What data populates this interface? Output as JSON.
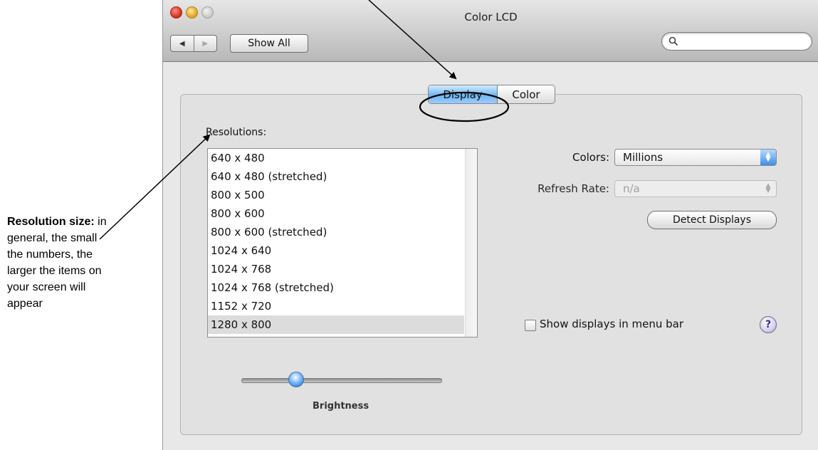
{
  "annotation": {
    "title_bold": "Resolution size:",
    "text": " in general, the small the numbers, the larger the items on your screen will appear"
  },
  "window": {
    "title": "Color LCD",
    "nav_back": "◀",
    "nav_forward": "▶",
    "show_all_label": "Show All",
    "search_value": ""
  },
  "tabs": [
    {
      "label": "Display",
      "selected": true
    },
    {
      "label": "Color",
      "selected": false
    }
  ],
  "resolutions": {
    "label": "Resolutions:",
    "items": [
      "640 x 480",
      "640 x 480 (stretched)",
      "800 x 500",
      "800 x 600",
      "800 x 600 (stretched)",
      "1024 x 640",
      "1024 x 768",
      "1024 x 768 (stretched)",
      "1152 x 720",
      "1280 x 800"
    ],
    "selected": "1280 x 800"
  },
  "colors": {
    "label": "Colors:",
    "value": "Millions"
  },
  "refresh_rate": {
    "label": "Refresh Rate:",
    "value": "n/a",
    "disabled": true
  },
  "detect_displays_label": "Detect Displays",
  "show_displays_in_menu_bar": {
    "label": "Show displays in menu bar",
    "checked": false
  },
  "help_label": "?",
  "brightness": {
    "label": "Brightness",
    "level": 0.27
  },
  "colors_theme": {
    "accent": "#3f8ee8",
    "window_bg": "#e8e8e8",
    "selected_row": "#dcdcdc"
  }
}
